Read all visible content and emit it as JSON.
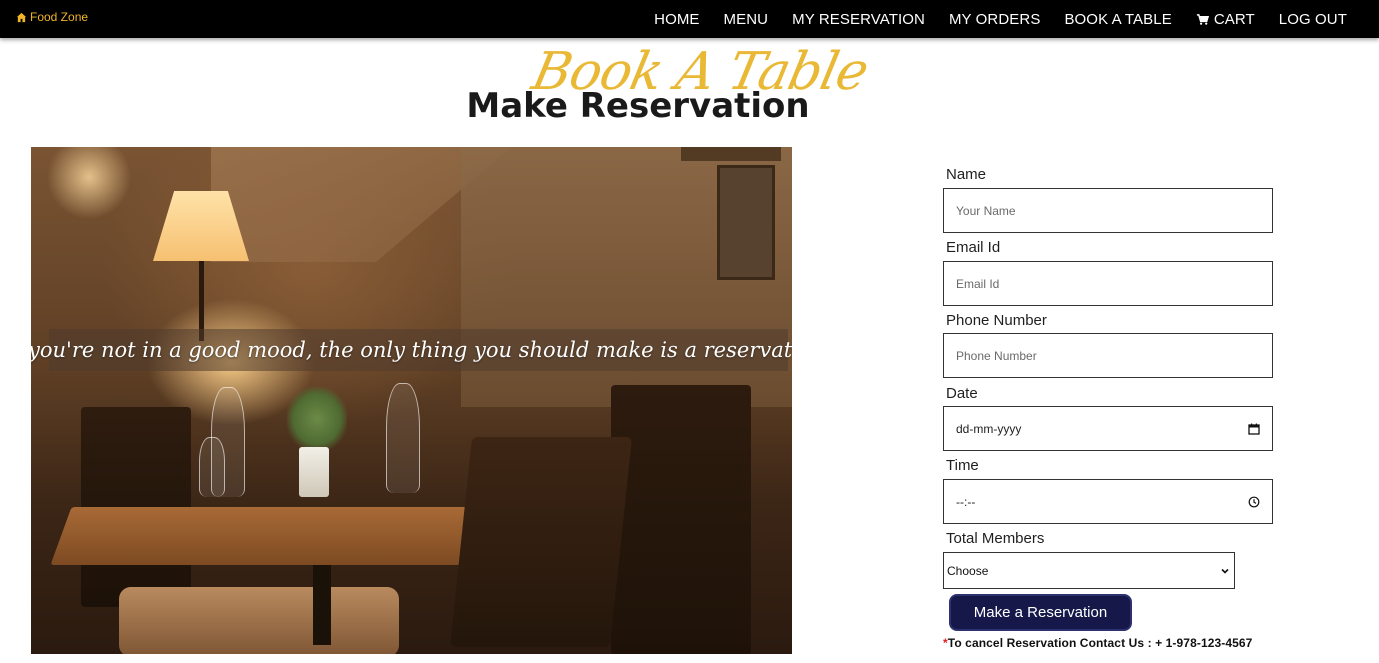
{
  "navbar": {
    "brand": "Food Zone",
    "brand_icon": "home-icon",
    "links": [
      "HOME",
      "MENU",
      "MY RESERVATION",
      "MY ORDERS",
      "BOOK A TABLE",
      "CART",
      "LOG OUT"
    ],
    "cart_icon": "cart-icon",
    "background": "#000000",
    "brand_color": "#f0b429"
  },
  "hero": {
    "script_title": "Book A Table",
    "title": "Make Reservation",
    "script_color": "#e8b52a"
  },
  "photo": {
    "quote": "If you're not in a good mood, the only thing you should make is a reservation."
  },
  "form": {
    "name": {
      "label": "Name",
      "placeholder": "Your Name"
    },
    "email": {
      "label": "Email Id",
      "placeholder": "Email Id"
    },
    "phone": {
      "label": "Phone Number",
      "placeholder": "Phone Number"
    },
    "date": {
      "label": "Date",
      "value": "dd-mm-yyyy"
    },
    "time": {
      "label": "Time",
      "value": "--:--"
    },
    "members": {
      "label": "Total Members",
      "value": "Choose"
    },
    "submit_label": "Make a Reservation",
    "submit_color": "#16184a",
    "cancel_asterisk": "*",
    "cancel_note": "To cancel Reservation Contact Us : + 1-978-123-4567"
  }
}
